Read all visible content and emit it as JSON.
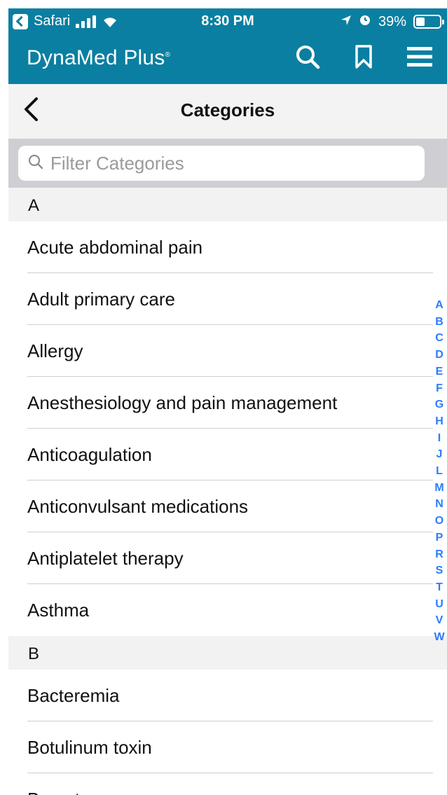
{
  "status_bar": {
    "back_app": "Safari",
    "time": "8:30 PM",
    "battery": "39%",
    "battery_level": 0.39
  },
  "app_bar": {
    "brand": "DynaMed Plus",
    "brand_mark": "®",
    "icons": [
      "search-icon",
      "bookmark-icon",
      "menu-icon"
    ]
  },
  "nav": {
    "title": "Categories"
  },
  "search": {
    "placeholder": "Filter Categories"
  },
  "sections": [
    {
      "letter": "A",
      "items": [
        "Acute abdominal pain",
        "Adult primary care",
        "Allergy",
        "Anesthesiology and pain management",
        "Anticoagulation",
        "Anticonvulsant medications",
        "Antiplatelet therapy",
        "Asthma"
      ]
    },
    {
      "letter": "B",
      "items": [
        "Bacteremia",
        "Botulinum toxin",
        "Breast cancer"
      ]
    }
  ],
  "index_letters": [
    "A",
    "B",
    "C",
    "D",
    "E",
    "F",
    "G",
    "H",
    "I",
    "J",
    "L",
    "M",
    "N",
    "O",
    "P",
    "R",
    "S",
    "T",
    "U",
    "V",
    "W"
  ],
  "colors": {
    "brand": "#0b7fa1",
    "index": "#2b7cff"
  }
}
